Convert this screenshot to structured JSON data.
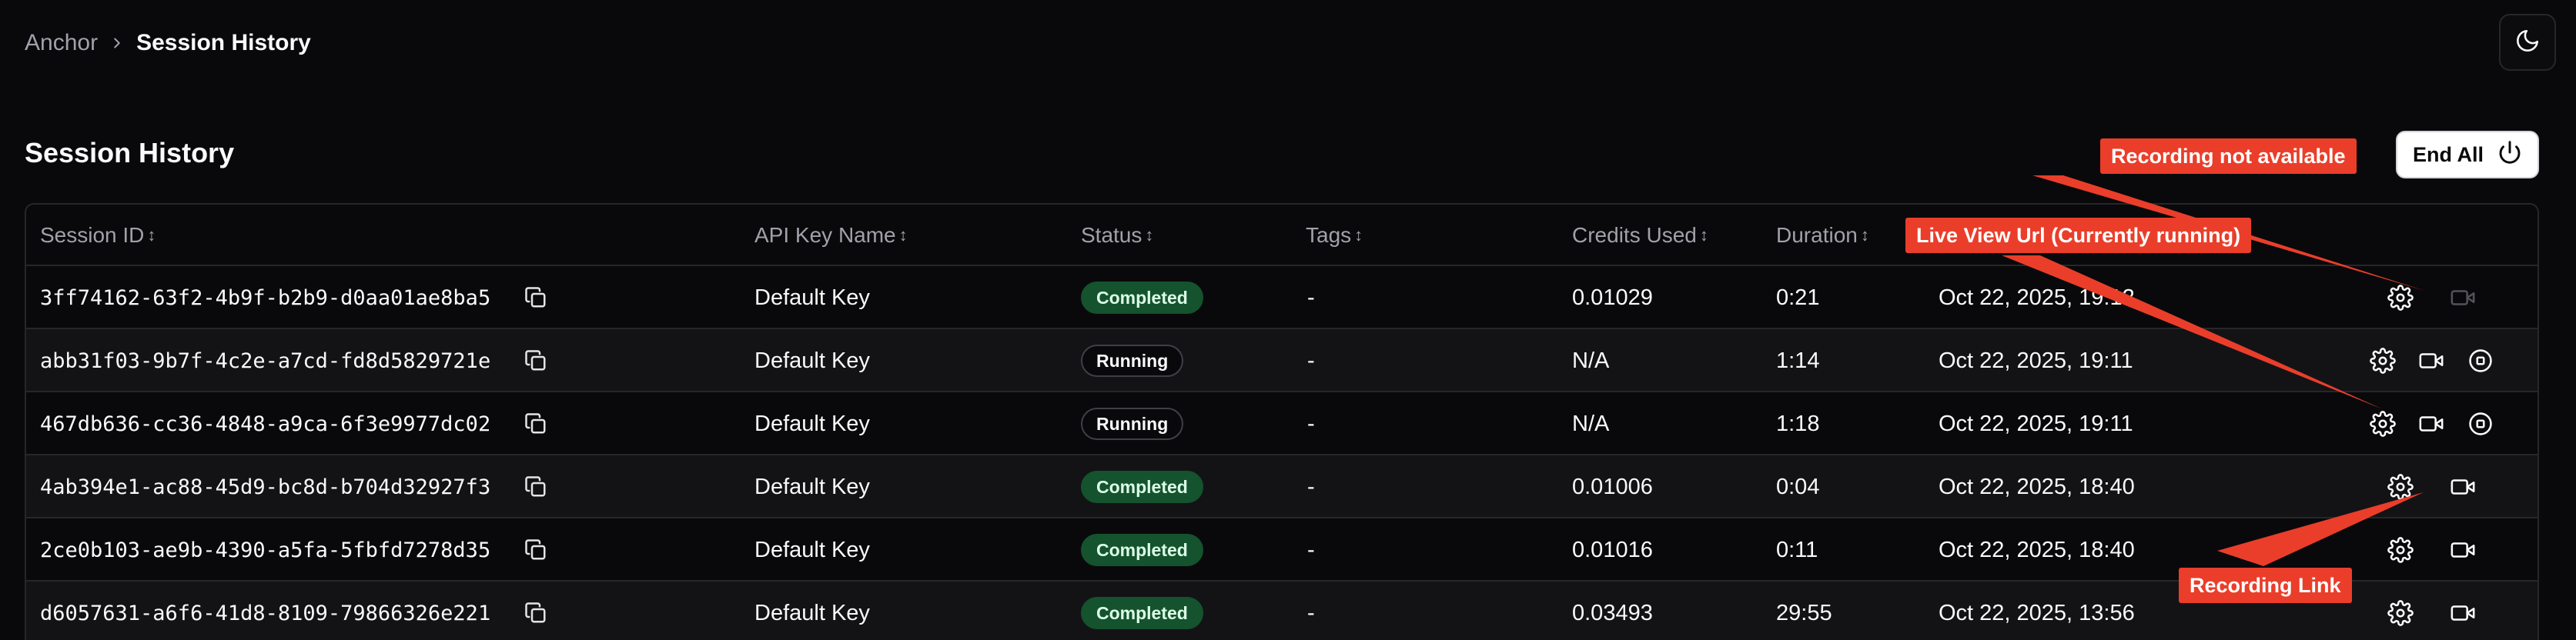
{
  "breadcrumb": {
    "root": "Anchor",
    "current": "Session History"
  },
  "page": {
    "title": "Session History",
    "end_all_label": "End All"
  },
  "table": {
    "headers": {
      "session_id": "Session ID",
      "api_key_name": "API Key Name",
      "status": "Status",
      "tags": "Tags",
      "credits_used": "Credits Used",
      "duration": "Duration"
    },
    "sort_glyph": "↕",
    "rows": [
      {
        "session_id": "3ff74162-63f2-4b9f-b2b9-d0aa01ae8ba5",
        "api_key_name": "Default Key",
        "status": "Completed",
        "tags": "-",
        "credits_used": "0.01029",
        "duration": "0:21",
        "date": "Oct 22, 2025, 19:12"
      },
      {
        "session_id": "abb31f03-9b7f-4c2e-a7cd-fd8d5829721e",
        "api_key_name": "Default Key",
        "status": "Running",
        "tags": "-",
        "credits_used": "N/A",
        "duration": "1:14",
        "date": "Oct 22, 2025, 19:11"
      },
      {
        "session_id": "467db636-cc36-4848-a9ca-6f3e9977dc02",
        "api_key_name": "Default Key",
        "status": "Running",
        "tags": "-",
        "credits_used": "N/A",
        "duration": "1:18",
        "date": "Oct 22, 2025, 19:11"
      },
      {
        "session_id": "4ab394e1-ac88-45d9-bc8d-b704d32927f3",
        "api_key_name": "Default Key",
        "status": "Completed",
        "tags": "-",
        "credits_used": "0.01006",
        "duration": "0:04",
        "date": "Oct 22, 2025, 18:40"
      },
      {
        "session_id": "2ce0b103-ae9b-4390-a5fa-5fbfd7278d35",
        "api_key_name": "Default Key",
        "status": "Completed",
        "tags": "-",
        "credits_used": "0.01016",
        "duration": "0:11",
        "date": "Oct 22, 2025, 18:40"
      },
      {
        "session_id": "d6057631-a6f6-41d8-8109-79866326e221",
        "api_key_name": "Default Key",
        "status": "Completed",
        "tags": "-",
        "credits_used": "0.03493",
        "duration": "29:55",
        "date": "Oct 22, 2025, 13:56"
      }
    ]
  },
  "annotations": {
    "recording_not_available": "Recording not available",
    "live_view_url": "Live View Url (Currently running)",
    "recording_link": "Recording Link"
  },
  "colors": {
    "background": "#09090b",
    "row_alt": "#131316",
    "border": "#27272a",
    "completed_badge": "#14532d",
    "callout": "#ea3e2a"
  },
  "icons": [
    "chevron-right-icon",
    "moon-icon",
    "power-icon",
    "copy-icon",
    "gear-icon",
    "video-icon",
    "stop-circle-icon"
  ]
}
